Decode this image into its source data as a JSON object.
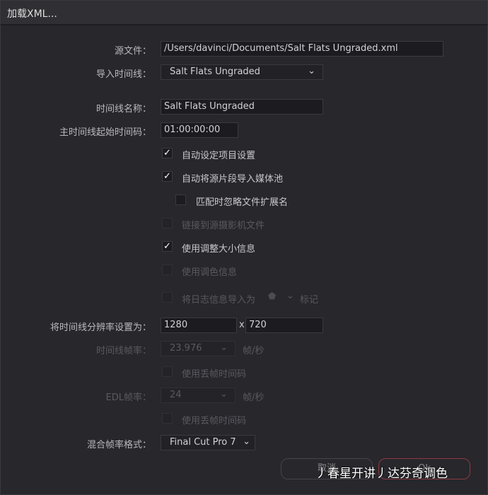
{
  "title": "加载XML...",
  "source_file": {
    "label": "源文件：",
    "value": "/Users/davinci/Documents/Salt Flats Ungraded.xml"
  },
  "import_timeline": {
    "label": "导入时间线：",
    "value": "Salt Flats Ungraded"
  },
  "timeline_name": {
    "label": "时间线名称：",
    "value": "Salt Flats Ungraded"
  },
  "start_timecode": {
    "label": "主时间线起始时间码：",
    "value": "01:00:00:00"
  },
  "checkboxes": [
    {
      "label": "自动设定项目设置",
      "checked": true,
      "enabled": true
    },
    {
      "label": "自动将源片段导入媒体池",
      "checked": true,
      "enabled": true
    },
    {
      "label": "匹配时忽略文件扩展名",
      "checked": false,
      "enabled": true
    },
    {
      "label": "链接到源摄影机文件",
      "checked": false,
      "enabled": false
    },
    {
      "label": "使用调整大小信息",
      "checked": true,
      "enabled": true
    },
    {
      "label": "使用调色信息",
      "checked": false,
      "enabled": false
    },
    {
      "label": "将日志信息导入为",
      "checked": false,
      "enabled": false
    }
  ],
  "log_marker_label": "标记",
  "resolution": {
    "label": "将时间线分辨率设置为：",
    "width": "1280",
    "sep": "x",
    "height": "720"
  },
  "timeline_fps": {
    "label": "时间线帧率：",
    "value": "23.976",
    "unit": "帧/秒"
  },
  "drop_frame_1": "使用丢帧时间码",
  "edl_fps": {
    "label": "EDL帧率：",
    "value": "24",
    "unit": "帧/秒"
  },
  "drop_frame_2": "使用丢帧时间码",
  "mixed_fps": {
    "label": "混合帧率格式：",
    "value": "Final Cut Pro 7"
  },
  "buttons": {
    "cancel": "取消",
    "ok": "Ok"
  },
  "watermark": "丿春星开讲丿达芬奇调色",
  "colors": {
    "ok_border": "#8a3a3f",
    "bg": "#28272c"
  }
}
